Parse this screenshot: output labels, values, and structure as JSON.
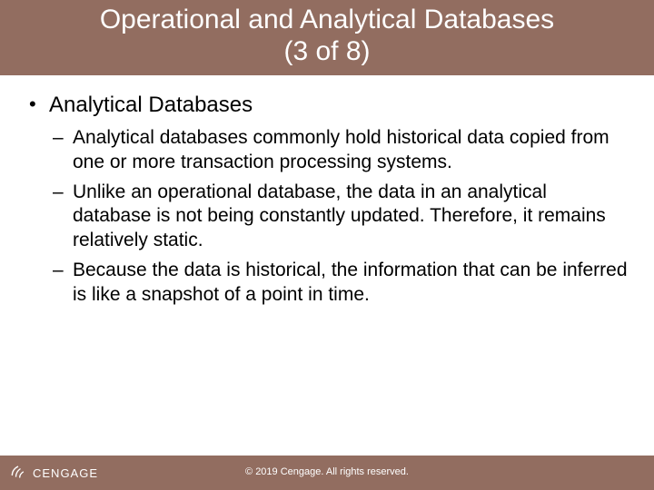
{
  "title": "Operational and Analytical Databases\n(3 of 8)",
  "main_bullet": "Analytical Databases",
  "sub_bullets": [
    "Analytical databases commonly hold historical data copied from one or more transaction processing systems.",
    "Unlike an operational database, the data in an analytical database is not being constantly updated. Therefore, it remains relatively static.",
    "Because the data is historical, the information that can be inferred is like a snapshot of a point in time."
  ],
  "brand": "CENGAGE",
  "copyright": "© 2019 Cengage. All rights reserved."
}
